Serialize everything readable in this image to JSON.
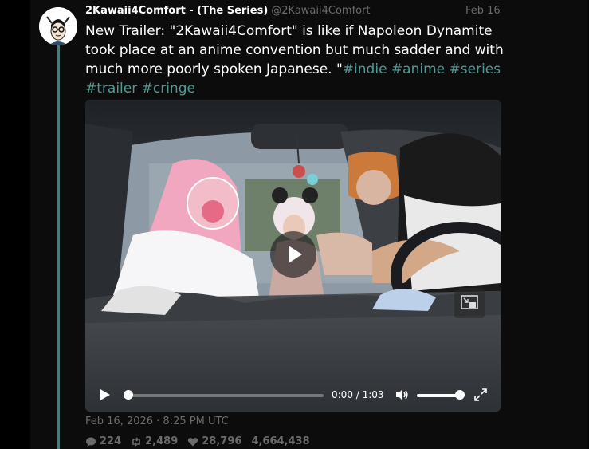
{
  "post": {
    "display_name": "2Kawaii4Comfort - (The Series)",
    "handle": "@2Kawaii4Comfort",
    "date": "Feb 16",
    "text_main": "New Trailer: \"2Kawaii4Comfort\" is like if Napoleon Dynamite took place at an anime convention but much sadder and with much more poorly spoken Japanese. \"",
    "hashtags": [
      "#indie",
      "#anime",
      "#series",
      "#trailer",
      "#cringe"
    ],
    "timestamp": "Feb 16, 2026 · 8:25 PM UTC"
  },
  "video": {
    "current_time": "0:00",
    "duration": "1:03",
    "time_display": "0:00 / 1:03",
    "progress": 0,
    "volume": 1
  },
  "stats": {
    "replies": "224",
    "reposts": "2,489",
    "likes": "28,796",
    "views": "4,664,438"
  },
  "colors": {
    "background": "#000000",
    "panel": "#0c0c0c",
    "hashtag": "#4f9a94",
    "muted": "#6b6b6b",
    "thread_line": "#4d7a78"
  },
  "icons": [
    "avatar",
    "play-icon",
    "picture-in-picture-icon",
    "volume-icon",
    "fullscreen-icon",
    "comment-icon",
    "repost-icon",
    "heart-icon"
  ]
}
